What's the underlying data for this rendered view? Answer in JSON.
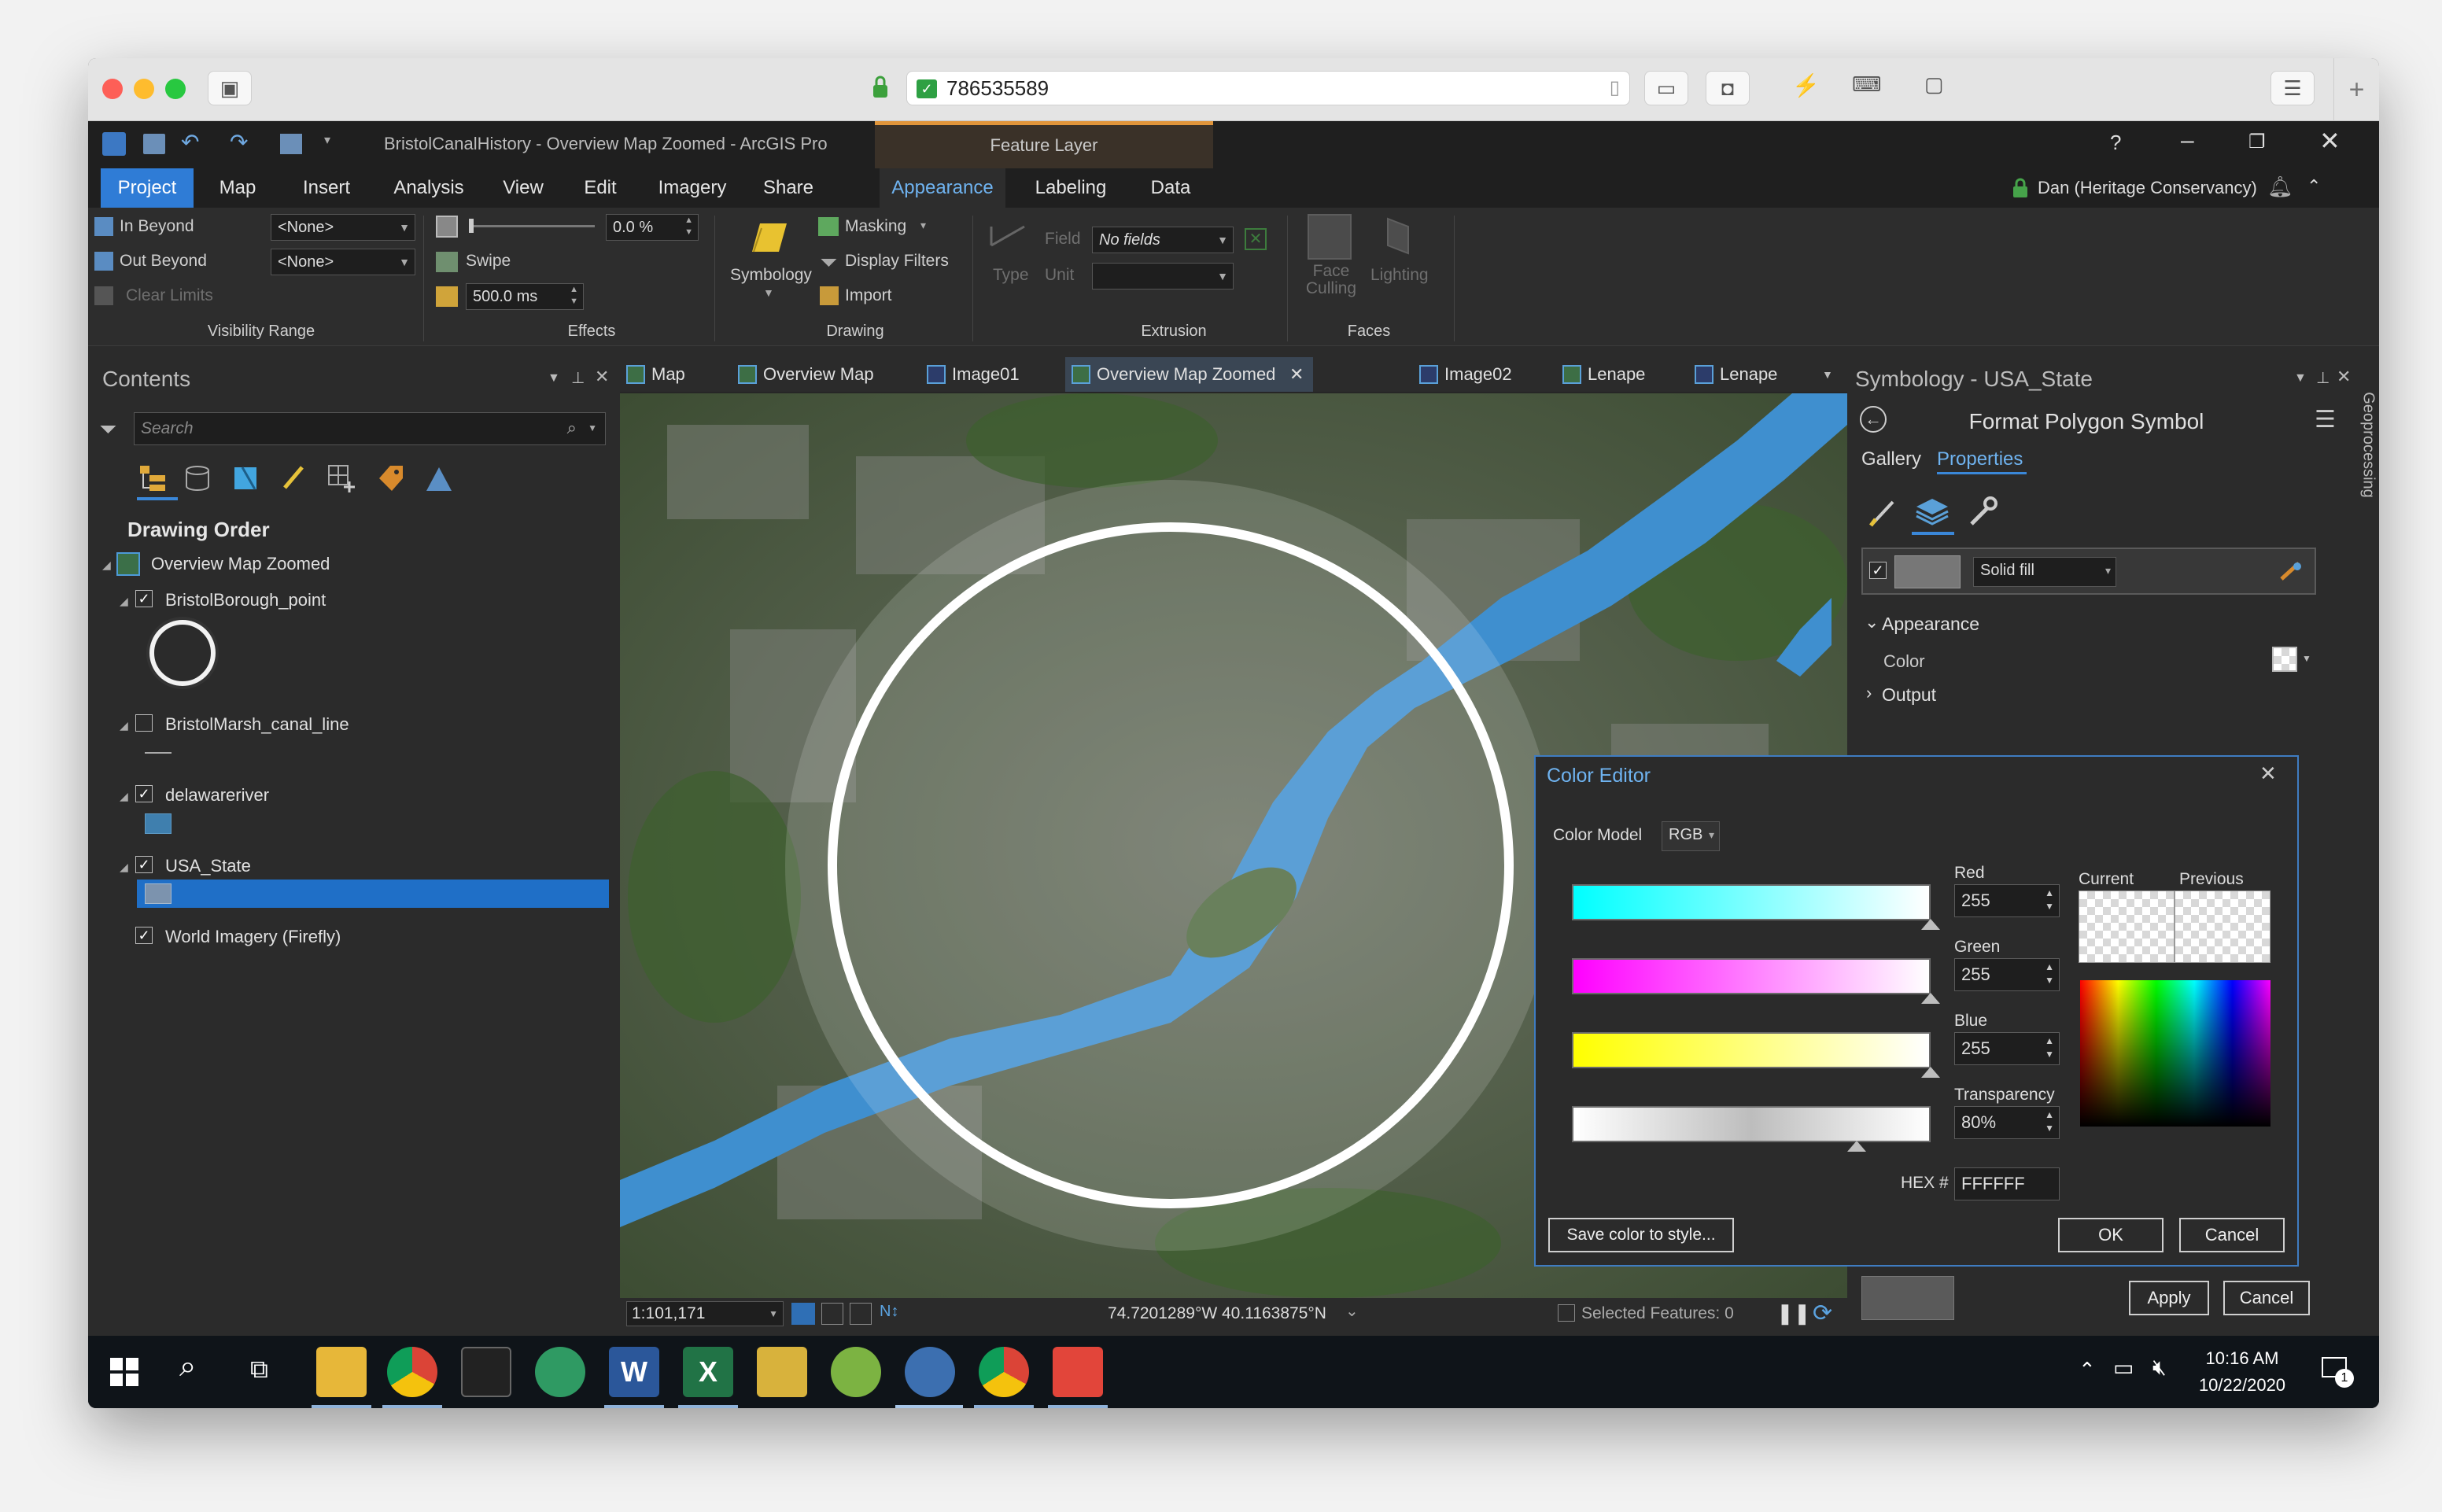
{
  "app": {
    "window_title": "BristolCanalHistory - Overview Map Zoomed - ArcGIS Pro",
    "contextual_tab_group": "Feature Layer",
    "help": "?",
    "user": "Dan (Heritage Conservancy)",
    "browser_address": "786535589"
  },
  "ribbon_tabs": [
    "Project",
    "Map",
    "Insert",
    "Analysis",
    "View",
    "Edit",
    "Imagery",
    "Share",
    "Appearance",
    "Labeling",
    "Data"
  ],
  "ribbon": {
    "visibility": {
      "in_beyond": "In Beyond",
      "out_beyond": "Out Beyond",
      "clear_limits": "Clear Limits",
      "in_value": "<None>",
      "out_value": "<None>",
      "group": "Visibility Range"
    },
    "effects": {
      "transparency": "0.0 %",
      "swipe": "Swipe",
      "flicker": "500.0  ms",
      "group": "Effects"
    },
    "drawing": {
      "symbology": "Symbology",
      "masking": "Masking",
      "display_filters": "Display Filters",
      "import": "Import",
      "group": "Drawing"
    },
    "extrusion": {
      "type": "Type",
      "field": "Field",
      "field_value": "No fields",
      "unit": "Unit",
      "group": "Extrusion"
    },
    "faces": {
      "face_culling": "Face\nCulling",
      "lighting": "Lighting",
      "group": "Faces"
    }
  },
  "contents": {
    "title": "Contents",
    "search_placeholder": "Search",
    "heading": "Drawing Order",
    "map_name": "Overview Map Zoomed",
    "layers": [
      {
        "name": "BristolBorough_point",
        "checked": true
      },
      {
        "name": "BristolMarsh_canal_line",
        "checked": false
      },
      {
        "name": "delawareriver",
        "checked": true
      },
      {
        "name": "USA_State",
        "checked": true
      },
      {
        "name": "World Imagery (Firefly)",
        "checked": true
      }
    ]
  },
  "map_tabs": [
    "Map",
    "Overview Map",
    "Image01",
    "Overview Map Zoomed",
    "Image02",
    "Lenape",
    "Lenape"
  ],
  "map_status": {
    "scale": "1:101,171",
    "coords": "74.7201289°W 40.1163875°N",
    "selected": "Selected Features: 0"
  },
  "symbology": {
    "title": "Symbology - USA_State",
    "subtitle": "Format Polygon Symbol",
    "tabs": [
      "Gallery",
      "Properties"
    ],
    "layer_type": "Solid fill",
    "appearance": "Appearance",
    "color_label": "Color",
    "output": "Output",
    "apply": "Apply",
    "cancel": "Cancel",
    "geoprocessing": "Geoprocessing"
  },
  "color_editor": {
    "title": "Color Editor",
    "model_label": "Color Model",
    "model_value": "RGB",
    "red_label": "Red",
    "red": "255",
    "green_label": "Green",
    "green": "255",
    "blue_label": "Blue",
    "blue": "255",
    "transparency_label": "Transparency",
    "transparency": "80%",
    "hex_label": "HEX #",
    "hex": "FFFFFF",
    "current": "Current",
    "previous": "Previous",
    "save": "Save color to style...",
    "ok": "OK",
    "cancel": "Cancel"
  },
  "taskbar": {
    "time": "10:16 AM",
    "date": "10/22/2020",
    "notifications": "1"
  },
  "colors": {
    "accent": "#2f7cd6",
    "river": "#3f8fcf",
    "ribbon_bg": "#2d2d2d",
    "panel_bg": "#2b2b2b",
    "appearance_tab": "#6fb3f0"
  }
}
